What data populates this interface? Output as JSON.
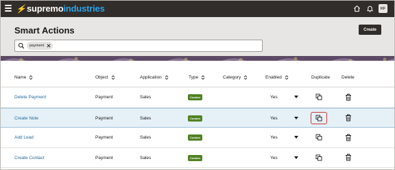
{
  "brand": {
    "part1": "supremo",
    "part2": "industries"
  },
  "topbar": {
    "avatar_initials": "KF",
    "icons": [
      "home-icon",
      "bell-icon"
    ]
  },
  "page": {
    "title": "Smart Actions",
    "create_label": "Create"
  },
  "search": {
    "filter_chip": "payment"
  },
  "table": {
    "columns": [
      "Name",
      "Object",
      "Application",
      "Type",
      "Category",
      "Enabled",
      "Duplicate",
      "Delete"
    ],
    "rows": [
      {
        "name": "Delete Payment",
        "object": "Payment",
        "application": "Sales",
        "type": "Custom",
        "category": "",
        "enabled": "Yes"
      },
      {
        "name": "Create Note",
        "object": "Payment",
        "application": "Sales",
        "type": "Custom",
        "category": "",
        "enabled": "Yes",
        "selected": true
      },
      {
        "name": "Add Lead",
        "object": "Payment",
        "application": "Sales",
        "type": "Custom",
        "category": "",
        "enabled": "Yes"
      },
      {
        "name": "Create Contact",
        "object": "Payment",
        "application": "Sales",
        "type": "Custom",
        "category": "",
        "enabled": "Yes"
      }
    ]
  },
  "colors": {
    "topbar": "#312d2a",
    "brand_accent": "#2ba3ea",
    "link": "#22699b",
    "badge": "#508223",
    "highlight": "#c5382f",
    "selected_row": "#e5f0f7"
  }
}
